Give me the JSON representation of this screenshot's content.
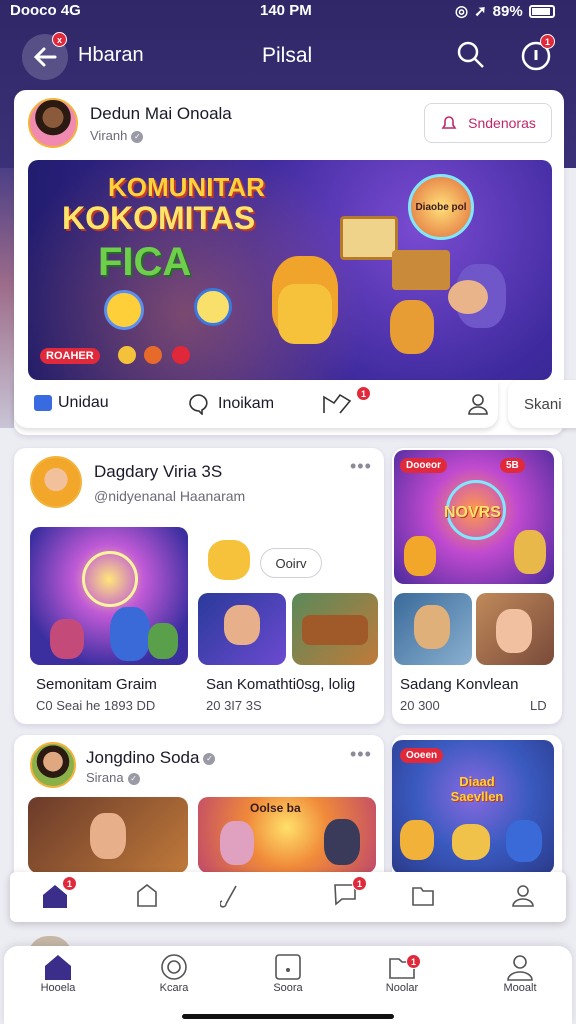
{
  "status_bar": {
    "carrier": "Dooco 4G",
    "time": "140 PM",
    "battery": "89%"
  },
  "header": {
    "back_label": "Hbaran",
    "title": "Pilsal"
  },
  "post1": {
    "author": "Dedun Mai Onoala",
    "handle": "Viranh",
    "follow_label": "Sndenoras",
    "banner": {
      "line1": "KOMUNITAR",
      "line2": "KOKOMITAS",
      "line3": "FICA",
      "bubble": "Diaobe pol",
      "tag": "ROAHER"
    },
    "actions": {
      "like": "Unidau",
      "comment": "Inoikam",
      "share_badge": "1",
      "side": "Skani"
    }
  },
  "post2": {
    "author": "Dagdary Viria 3S",
    "handle": "@nidyenanal Haanaram",
    "menu": "•••",
    "chip_label": "Ooirv",
    "left_caption": "Semonitam Graim",
    "left_meta": "C0 Seai he 1893 DD",
    "mid_caption": "San Komathti0sg, lolig",
    "mid_meta": "20 3I7 3S"
  },
  "side_card1": {
    "pill": "Dooeor",
    "count": "5B",
    "banner": "NOVRS",
    "caption": "Sadang Konvlean",
    "meta": "20 300",
    "meta2": "LD"
  },
  "post3": {
    "author": "Jongdino Soda",
    "handle": "Sirana",
    "menu": "•••",
    "banner": "Oolse ba"
  },
  "side_card2": {
    "pill": "Ooeen",
    "banner": "Diaad Saevllen"
  },
  "inner_tabbar": {
    "icons": [
      "home-icon",
      "bag-icon",
      "music-icon",
      "chat-icon",
      "folder-icon",
      "profile-icon"
    ],
    "badges": [
      "1",
      "",
      "",
      "1",
      "",
      ""
    ]
  },
  "bottom_nav": {
    "items": [
      {
        "label": "Hooela",
        "icon": "home-icon"
      },
      {
        "label": "Kcara",
        "icon": "radar-icon"
      },
      {
        "label": "Soora",
        "icon": "square-icon"
      },
      {
        "label": "Noolar",
        "icon": "folder-icon",
        "badge": "1"
      },
      {
        "label": "Mooalt",
        "icon": "profile-icon"
      }
    ]
  },
  "colors": {
    "header": "#2f2767",
    "accent": "#c0276a",
    "badge": "#e02a3b",
    "brand": "#3b2d8a"
  }
}
